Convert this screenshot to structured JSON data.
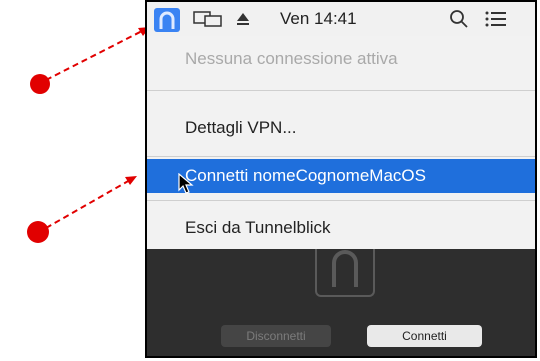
{
  "menubar": {
    "clock": "Ven 14:41",
    "icons": [
      "tunnelblick-icon",
      "display-mirror-icon",
      "eject-icon",
      "search-icon",
      "list-icon"
    ]
  },
  "menu": {
    "status": "Nessuna connessione attiva",
    "details": "Dettagli VPN...",
    "connect": "Connetti nomeCognomeMacOS",
    "quit": "Esci da Tunnelblick"
  },
  "window": {
    "disconnect_label": "Disconnetti",
    "connect_label": "Connetti"
  },
  "colors": {
    "annotation": "#e10000",
    "selection": "#1f6fdc",
    "tunnelblick_icon": "#3a83f3"
  }
}
